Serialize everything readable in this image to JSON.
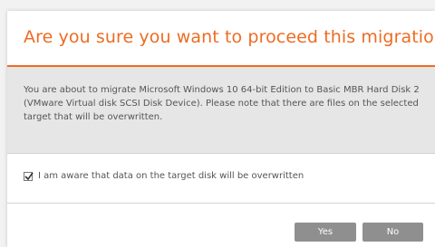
{
  "dialog": {
    "title": "Are you sure you want to proceed this migration?",
    "message": "You are about to migrate Microsoft Windows 10 64-bit Edition to Basic MBR Hard Disk 2 (VMware Virtual disk SCSI Disk Device). Please note that there are files on the selected target that will be overwritten.",
    "confirm_checkbox": {
      "checked": true,
      "label": "I am aware that data on the target disk will be overwritten"
    },
    "buttons": {
      "yes_label": "Yes",
      "no_label": "No"
    }
  },
  "colors": {
    "accent": "#ec6c23",
    "button": "#8f8f8f",
    "message_bg": "#e6e6e6"
  }
}
